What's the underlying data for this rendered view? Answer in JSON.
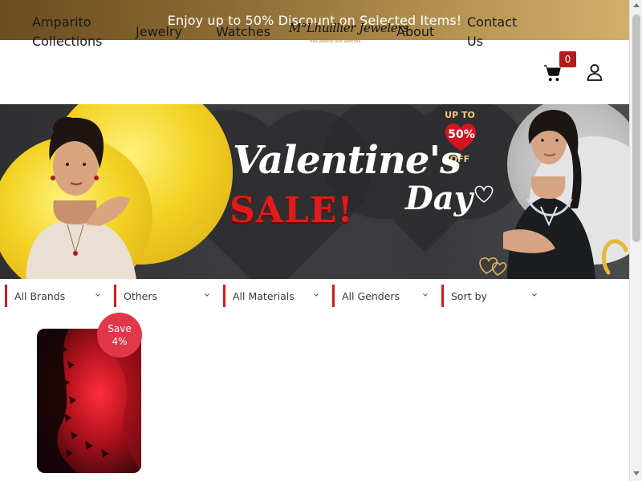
{
  "promo": {
    "text": "Enjoy up to 50% Discount on Selected Items!"
  },
  "nav": {
    "amparito": "Amparito Collections",
    "jewelry": "Jewelry",
    "watches": "Watches",
    "about": "About",
    "contact": "Contact Us"
  },
  "logo": {
    "script": "M°Lhuillier Jewelers",
    "tagline": "Fine Jewelry and Watches"
  },
  "cart": {
    "count": "0",
    "icon": "cart-icon"
  },
  "user": {
    "icon": "user-icon"
  },
  "hero": {
    "upto": "UP TO",
    "percent": "50%",
    "off": "OFF",
    "valentine": "Valentine's",
    "sale": "SALE!",
    "day": "Day"
  },
  "filters": [
    {
      "label": "All Brands"
    },
    {
      "label": "Others"
    },
    {
      "label": "All Materials"
    },
    {
      "label": "All Genders"
    },
    {
      "label": "Sort by"
    }
  ],
  "product": {
    "save_label": "Save",
    "save_percent": "4%"
  },
  "colors": {
    "accent": "#d31b1b",
    "badge": "#e2364a",
    "promo_start": "#6b4d1f",
    "promo_end": "#d2b06a",
    "cart_badge": "#b71c1c"
  }
}
